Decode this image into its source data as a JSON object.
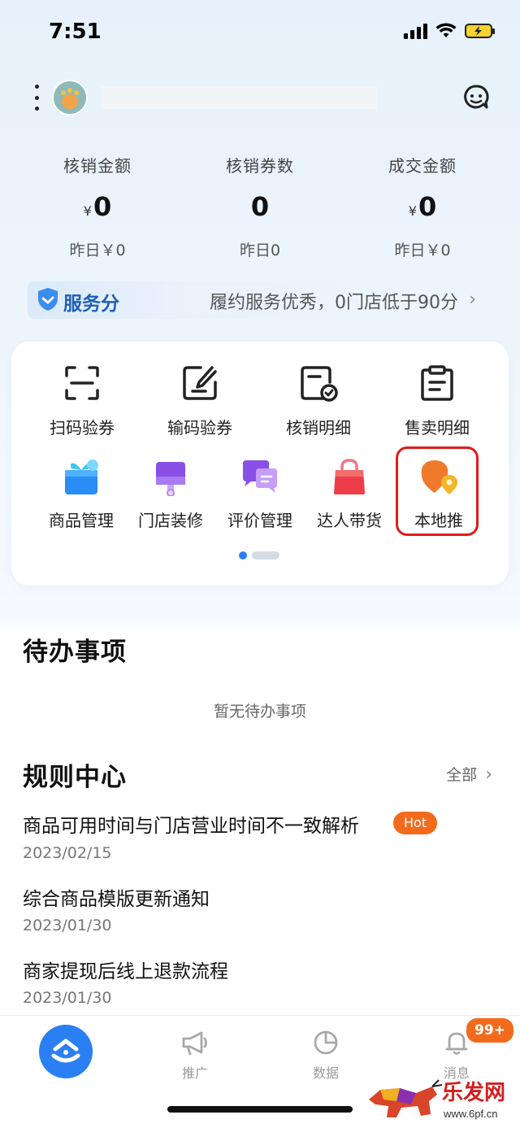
{
  "status": {
    "time": "7:51"
  },
  "stats": [
    {
      "label": "核销金额",
      "currency": "¥",
      "value": "0",
      "sub": "昨日￥0"
    },
    {
      "label": "核销券数",
      "currency": "",
      "value": "0",
      "sub": "昨日0"
    },
    {
      "label": "成交金额",
      "currency": "¥",
      "value": "0",
      "sub": "昨日￥0"
    }
  ],
  "service_score": {
    "title": "服务分",
    "text": "履约服务优秀，0门店低于90分"
  },
  "tools_row1": [
    {
      "label": "扫码验券",
      "icon": "scan-icon"
    },
    {
      "label": "输码验券",
      "icon": "edit-code-icon"
    },
    {
      "label": "核销明细",
      "icon": "verify-detail-icon"
    },
    {
      "label": "售卖明细",
      "icon": "clipboard-icon"
    }
  ],
  "tools_row2": [
    {
      "label": "商品管理",
      "icon": "gift-box-icon"
    },
    {
      "label": "门店装修",
      "icon": "shop-decorate-icon"
    },
    {
      "label": "评价管理",
      "icon": "chat-bubble-icon"
    },
    {
      "label": "达人带货",
      "icon": "shopping-bag-icon"
    },
    {
      "label": "本地推",
      "icon": "location-pin-icon"
    }
  ],
  "todo": {
    "title": "待办事项",
    "empty": "暂无待办事项"
  },
  "rules": {
    "title": "规则中心",
    "all": "全部",
    "items": [
      {
        "title": "商品可用时间与门店营业时间不一致解析",
        "date": "2023/02/15",
        "badge": "Hot"
      },
      {
        "title": "综合商品模版更新通知",
        "date": "2023/01/30"
      },
      {
        "title": "商家提现后线上退款流程",
        "date": "2023/01/30"
      }
    ]
  },
  "tabbar": {
    "tabs": [
      {
        "label": "推广",
        "icon": "megaphone-icon"
      },
      {
        "label": "数据",
        "icon": "pie-chart-icon"
      },
      {
        "label": "消息",
        "icon": "bell-icon"
      }
    ],
    "badge": "99+"
  },
  "watermark": {
    "brand": "乐发网",
    "url": "www.6pf.cn"
  },
  "colors": {
    "accent": "#2a7ff2",
    "badge": "#f26b1d",
    "highlight": "#e11b1b",
    "score": "#1e5fb4"
  }
}
